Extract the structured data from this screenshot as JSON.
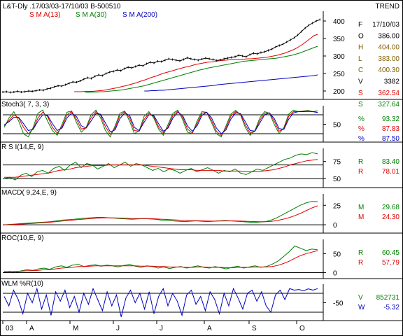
{
  "header": {
    "title": "L&T-Dly .17/03/03-17/10/03  B-500510",
    "right": "TREND"
  },
  "colors": {
    "red": "#e00000",
    "green": "#008000",
    "blue": "#0000c0",
    "price": "#000000",
    "grid": "#000000"
  },
  "chart_data": [
    {
      "type": "line",
      "panel": "price",
      "legend": [
        "S M A(13)",
        "S M A(30)",
        "S M A(200)"
      ],
      "yticks": [
        "400",
        "350",
        "300",
        "250",
        "200"
      ],
      "ylim": [
        180,
        420
      ],
      "x_sessions": 150,
      "series": [
        {
          "name": "Price",
          "values": [
            197,
            198,
            196,
            197,
            199,
            197,
            198,
            200,
            199,
            201,
            203,
            202,
            206,
            208,
            212,
            215,
            214,
            218,
            222,
            226,
            225,
            229,
            234,
            238,
            236,
            242,
            246,
            244,
            250,
            254,
            256,
            260,
            258,
            264,
            268,
            266,
            270,
            274,
            272,
            278,
            282,
            280,
            285,
            284,
            288,
            292,
            290,
            288,
            286,
            290,
            295,
            292,
            290,
            288,
            291,
            294,
            292,
            290,
            287,
            289,
            292,
            294,
            296,
            298,
            302,
            300,
            298,
            304,
            308,
            306,
            310,
            312,
            316,
            320,
            326,
            330,
            334,
            340,
            346,
            352,
            360,
            370,
            380,
            388,
            394,
            400,
            404
          ]
        },
        {
          "name": "S M A(13)",
          "values": [
            198,
            198,
            198,
            199,
            199,
            199,
            200,
            201,
            202,
            204,
            206,
            208,
            210,
            213,
            215,
            218,
            221,
            224,
            228,
            231,
            235,
            239,
            242,
            246,
            250,
            253,
            256,
            259,
            262,
            265,
            268,
            270,
            273,
            276,
            278,
            280,
            282,
            283,
            284,
            286,
            287,
            288,
            289,
            289,
            290,
            291,
            291,
            292,
            292,
            293,
            294,
            295,
            296,
            298,
            300,
            302,
            305,
            308,
            312,
            316,
            321,
            327,
            334,
            342,
            350,
            358,
            362
          ]
        },
        {
          "name": "S M A(30)",
          "values": [
            196,
            196,
            197,
            197,
            198,
            198,
            199,
            200,
            201,
            202,
            203,
            205,
            207,
            209,
            211,
            213,
            215,
            218,
            221,
            224,
            227,
            230,
            233,
            236,
            239,
            242,
            245,
            248,
            251,
            254,
            257,
            260,
            262,
            265,
            267,
            269,
            271,
            273,
            275,
            277,
            279,
            281,
            283,
            285,
            286,
            287,
            288,
            289,
            290,
            291,
            292,
            293,
            294,
            296,
            298,
            300,
            302,
            305,
            308,
            312,
            316,
            320,
            324,
            328
          ]
        },
        {
          "name": "S M A(200)",
          "values": [
            200,
            200,
            201,
            201,
            202,
            202,
            203,
            204,
            205,
            206,
            207,
            208,
            209,
            210,
            211,
            212,
            213,
            214,
            215,
            216,
            218,
            219,
            220,
            221,
            222,
            223,
            224,
            225,
            226,
            227,
            228,
            229,
            230,
            231,
            232,
            233,
            234,
            235,
            236,
            237,
            238,
            239,
            240,
            241,
            242,
            243,
            244,
            246
          ]
        }
      ],
      "readout": [
        {
          "label": "F",
          "value": "17/10/03"
        },
        {
          "label": "O",
          "value": "386.00"
        },
        {
          "label": "H",
          "value": "404.00"
        },
        {
          "label": "L",
          "value": "383.00"
        },
        {
          "label": "C",
          "value": "400.30"
        },
        {
          "label": "V",
          "value": "3382"
        },
        {
          "label": "S",
          "value": "362.54"
        },
        {
          "label": "S",
          "value": "327.64"
        }
      ]
    },
    {
      "type": "line",
      "panel": "stoch",
      "title": "Stoch3( 7, 3, 3)",
      "yticks": [
        "50"
      ],
      "ylim": [
        0,
        100
      ],
      "hlines": [
        20,
        80
      ],
      "series": [
        {
          "name": "%K",
          "values": [
            40,
            70,
            90,
            60,
            20,
            10,
            40,
            85,
            95,
            60,
            30,
            15,
            50,
            88,
            92,
            55,
            25,
            40,
            80,
            95,
            70,
            30,
            10,
            45,
            85,
            92,
            60,
            20,
            30,
            75,
            90,
            70,
            35,
            15,
            50,
            85,
            95,
            65,
            25,
            20,
            60,
            90,
            88,
            55,
            20,
            10,
            45,
            82,
            94,
            80,
            40,
            15,
            30,
            70,
            90,
            85,
            50,
            20,
            40,
            82,
            95,
            90,
            92,
            94,
            90,
            93
          ]
        },
        {
          "name": "%D",
          "values": [
            45,
            62,
            80,
            70,
            40,
            20,
            35,
            70,
            88,
            75,
            40,
            22,
            42,
            80,
            90,
            65,
            35,
            38,
            70,
            90,
            78,
            42,
            18,
            38,
            78,
            90,
            70,
            30,
            28,
            65,
            85,
            75,
            42,
            22,
            42,
            78,
            92,
            72,
            35,
            22,
            52,
            85,
            88,
            62,
            28,
            14,
            38,
            75,
            90,
            82,
            48,
            22,
            28,
            62,
            85,
            86,
            60,
            28,
            36,
            75,
            90,
            90,
            91,
            92,
            90,
            88
          ]
        },
        {
          "name": "%",
          "values": [
            48,
            58,
            72,
            72,
            52,
            30,
            34,
            60,
            80,
            78,
            52,
            30,
            38,
            70,
            86,
            74,
            45,
            38,
            60,
            84,
            82,
            54,
            26,
            32,
            68,
            86,
            78,
            40,
            30,
            56,
            80,
            78,
            52,
            28,
            38,
            70,
            88,
            78,
            45,
            28,
            45,
            78,
            88,
            70,
            38,
            20,
            32,
            66,
            86,
            84,
            58,
            30,
            28,
            54,
            80,
            86,
            68,
            36,
            34,
            66,
            86,
            90,
            90,
            91,
            90,
            87
          ]
        }
      ],
      "readout": [
        {
          "label": "%",
          "value": "93.32"
        },
        {
          "label": "%",
          "value": "87.83"
        },
        {
          "label": "%",
          "value": "87.50"
        }
      ]
    },
    {
      "type": "line",
      "panel": "rsi",
      "title": "R S I(14,E, 9)",
      "yticks": [
        "75",
        "50"
      ],
      "ylim": [
        40,
        90
      ],
      "hlines": [
        70,
        50
      ],
      "series": [
        {
          "name": "RSI",
          "values": [
            50,
            52,
            48,
            55,
            58,
            53,
            60,
            62,
            58,
            65,
            68,
            62,
            70,
            74,
            66,
            72,
            70,
            64,
            68,
            72,
            66,
            70,
            74,
            68,
            72,
            70,
            66,
            62,
            65,
            60,
            64,
            62,
            58,
            62,
            65,
            60,
            63,
            66,
            62,
            58,
            62,
            60,
            64,
            58,
            56,
            60,
            64,
            62,
            66,
            70,
            74,
            78,
            80,
            84,
            86,
            85,
            88,
            86
          ]
        },
        {
          "name": "Signal",
          "values": [
            52,
            52,
            52,
            53,
            54,
            55,
            56,
            57,
            58,
            60,
            62,
            63,
            64,
            66,
            67,
            68,
            69,
            69,
            69,
            70,
            70,
            70,
            70,
            70,
            70,
            70,
            69,
            68,
            67,
            66,
            65,
            64,
            63,
            63,
            63,
            62,
            62,
            62,
            62,
            62,
            61,
            61,
            61,
            61,
            60,
            60,
            60,
            61,
            62,
            63,
            65,
            67,
            70,
            72,
            74,
            76,
            77,
            78
          ]
        }
      ],
      "readout": [
        {
          "label": "R",
          "value": "83.40"
        },
        {
          "label": "R",
          "value": "78.01"
        }
      ]
    },
    {
      "type": "line",
      "panel": "macd",
      "title": "MACD( 9,24,E, 9)",
      "yticks": [
        "25",
        "0"
      ],
      "ylim": [
        -8,
        36
      ],
      "hlines": [
        0
      ],
      "series": [
        {
          "name": "MACD",
          "values": [
            0,
            0.5,
            1,
            1.5,
            2,
            2.5,
            3,
            3.5,
            4,
            5,
            6,
            6.5,
            7,
            8,
            8.5,
            9,
            9.5,
            9.5,
            9,
            8.5,
            8,
            7.5,
            7,
            7.5,
            8,
            7.5,
            7,
            6,
            5.5,
            5,
            4.5,
            4,
            4.5,
            5,
            4.5,
            4,
            4.5,
            5,
            5.5,
            5,
            4.5,
            4,
            3.5,
            3,
            3.5,
            4,
            6,
            9,
            13,
            17,
            21,
            25,
            28,
            30,
            29.7
          ]
        },
        {
          "name": "Signal",
          "values": [
            0,
            0.2,
            0.5,
            0.9,
            1.3,
            1.8,
            2.3,
            2.8,
            3.3,
            4,
            4.8,
            5.5,
            6.1,
            6.8,
            7.4,
            8,
            8.5,
            8.8,
            8.9,
            8.8,
            8.6,
            8.3,
            8,
            7.9,
            7.9,
            7.8,
            7.6,
            7.2,
            6.8,
            6.4,
            6,
            5.6,
            5.3,
            5.2,
            5,
            4.8,
            4.7,
            4.8,
            4.9,
            5,
            4.9,
            4.7,
            4.4,
            4.1,
            3.9,
            3.9,
            4.4,
            5.4,
            7,
            9,
            11.5,
            14.5,
            18,
            21.5,
            24.3
          ]
        }
      ],
      "readout": [
        {
          "label": "M",
          "value": "29.68"
        },
        {
          "label": "M",
          "value": "24.30"
        }
      ]
    },
    {
      "type": "line",
      "panel": "roc",
      "title": "ROC(10,E, 9)",
      "yticks": [
        "50",
        "0"
      ],
      "ylim": [
        -10,
        80
      ],
      "hlines": [
        0
      ],
      "series": [
        {
          "name": "ROC",
          "values": [
            2,
            4,
            1,
            5,
            8,
            6,
            10,
            12,
            9,
            15,
            18,
            14,
            20,
            22,
            16,
            19,
            21,
            17,
            20,
            18,
            15,
            19,
            22,
            17,
            14,
            18,
            16,
            12,
            15,
            11,
            14,
            16,
            12,
            15,
            18,
            14,
            12,
            16,
            13,
            10,
            14,
            17,
            12,
            15,
            18,
            14,
            16,
            22,
            30,
            42,
            55,
            70,
            64,
            58,
            62,
            60
          ]
        },
        {
          "name": "Signal",
          "values": [
            3,
            3,
            3,
            4,
            5,
            5,
            6,
            8,
            8,
            10,
            12,
            13,
            14,
            16,
            16,
            17,
            18,
            18,
            18,
            18,
            18,
            18,
            18,
            18,
            17,
            17,
            17,
            16,
            16,
            15,
            15,
            15,
            14,
            14,
            15,
            15,
            14,
            14,
            14,
            13,
            13,
            14,
            14,
            14,
            15,
            15,
            15,
            16,
            19,
            24,
            30,
            38,
            45,
            50,
            54,
            57.8
          ]
        }
      ],
      "readout": [
        {
          "label": "R",
          "value": "60.45"
        },
        {
          "label": "R",
          "value": "57.79"
        }
      ]
    },
    {
      "type": "line",
      "panel": "wlm",
      "title": "WLM %R(10)",
      "yticks": [
        "-50"
      ],
      "ylim": [
        -100,
        0
      ],
      "hlines": [
        -20,
        -80
      ],
      "series": [
        {
          "name": "%R",
          "values": [
            -30,
            -60,
            -10,
            -40,
            -85,
            -20,
            -50,
            -5,
            -70,
            -25,
            -90,
            -15,
            -45,
            -10,
            -65,
            -30,
            -80,
            -20,
            -55,
            -5,
            -40,
            -75,
            -15,
            -60,
            -25,
            -95,
            -35,
            -10,
            -50,
            -20,
            -70,
            -15,
            -85,
            -30,
            -5,
            -60,
            -20,
            -45,
            -90,
            -25,
            -10,
            -55,
            -30,
            -75,
            -15,
            -40,
            -85,
            -20,
            -60,
            -5,
            -35,
            -70,
            -20,
            -10,
            -45,
            -15,
            -60,
            -80,
            -25,
            -10,
            -40,
            -5,
            -10,
            -8,
            -12,
            -6,
            -10,
            -5
          ]
        }
      ],
      "readout": [
        {
          "label": "V",
          "value": "852731"
        },
        {
          "label": "W",
          "value": "-5.32"
        }
      ]
    }
  ],
  "xaxis": {
    "labels": [
      "03",
      "A",
      "M",
      "J",
      "J",
      "A",
      "S",
      "O"
    ]
  }
}
